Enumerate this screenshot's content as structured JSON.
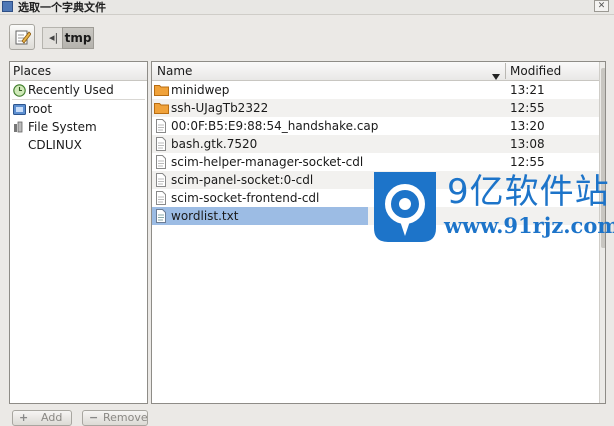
{
  "window": {
    "title": "选取一个字典文件"
  },
  "toolbar": {
    "path_current": "tmp",
    "path_back_glyph": "◂|"
  },
  "places": {
    "header": "Places",
    "items": [
      {
        "label": "Recently Used",
        "icon": "clock-icon"
      },
      {
        "label": "root",
        "icon": "home-icon"
      },
      {
        "label": "File System",
        "icon": "drive-icon"
      },
      {
        "label": "CDLINUX",
        "icon": "none"
      }
    ],
    "add_label": "Add",
    "remove_label": "Remove"
  },
  "files": {
    "columns": {
      "name": "Name",
      "modified": "Modified",
      "sort_indicator": "▼"
    },
    "rows": [
      {
        "name": "minidwep",
        "modified": "13:21",
        "type": "folder"
      },
      {
        "name": "ssh-UJagTb2322",
        "modified": "12:55",
        "type": "folder"
      },
      {
        "name": "00:0F:B5:E9:88:54_handshake.cap",
        "modified": "13:20",
        "type": "file"
      },
      {
        "name": "bash.gtk.7520",
        "modified": "13:08",
        "type": "file"
      },
      {
        "name": "scim-helper-manager-socket-cdl",
        "modified": "12:55",
        "type": "file"
      },
      {
        "name": "scim-panel-socket:0-cdl",
        "modified": "",
        "type": "file"
      },
      {
        "name": "scim-socket-frontend-cdl",
        "modified": "",
        "type": "file"
      },
      {
        "name": "wordlist.txt",
        "modified": "",
        "type": "file",
        "selected": true
      }
    ]
  },
  "watermark": {
    "brand": "9亿软件站",
    "url": "www.91rjz.com"
  },
  "colors": {
    "selection": "#9cbce4",
    "folder": "#f0a23a",
    "brand": "#1d74c9"
  }
}
